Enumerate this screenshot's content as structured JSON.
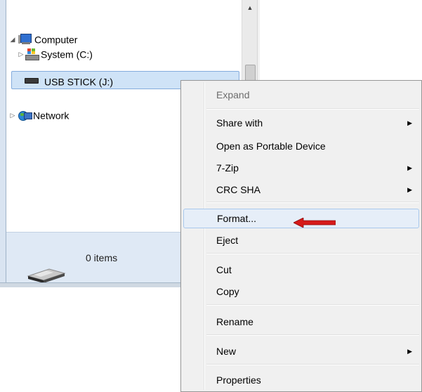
{
  "tree": {
    "computer_label": "Computer",
    "system_label": "System (C:)",
    "usb_label": "USB STICK (J:)",
    "network_label": "Network"
  },
  "status": {
    "item_count": "0 items"
  },
  "menu": {
    "expand": "Expand",
    "share_with": "Share with",
    "open_portable": "Open as Portable Device",
    "zip": "7-Zip",
    "crc": "CRC SHA",
    "format": "Format...",
    "eject": "Eject",
    "cut": "Cut",
    "copy": "Copy",
    "rename": "Rename",
    "new": "New",
    "properties": "Properties"
  },
  "colors": {
    "selection": "#cfe3f7",
    "annotation_arrow": "#d61a1a"
  }
}
